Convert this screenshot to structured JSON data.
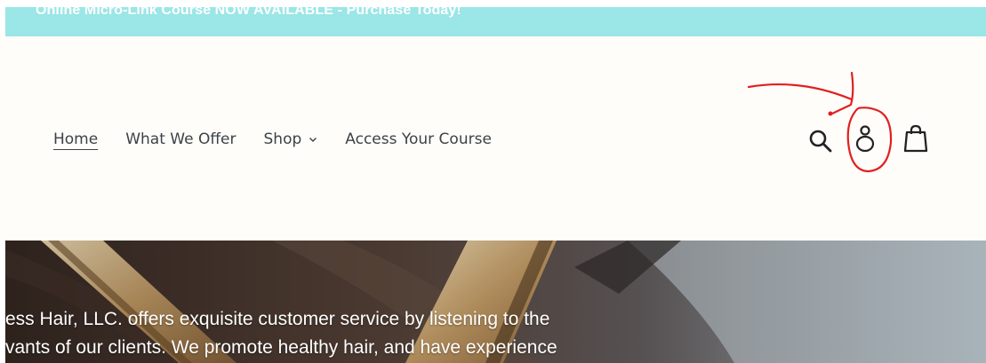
{
  "announcement": {
    "text": "Online Micro-Link Course NOW AVAILABLE - Purchase Today!",
    "background": "#9be6e6"
  },
  "nav": {
    "items": [
      {
        "label": "Home",
        "active": true
      },
      {
        "label": "What We Offer"
      },
      {
        "label": "Shop",
        "has_dropdown": true
      },
      {
        "label": "Access Your Course"
      }
    ]
  },
  "header_icons": {
    "search": "search-icon",
    "account": "account-icon",
    "cart": "cart-icon"
  },
  "annotation": {
    "color": "#e02020"
  },
  "hero": {
    "line1": "ess Hair, LLC. offers exquisite customer service by listening to the",
    "line2": "vants of our clients. We promote healthy hair, and have experience"
  },
  "colors": {
    "header_bg": "#fefdfa",
    "nav_text": "#3d4246"
  }
}
